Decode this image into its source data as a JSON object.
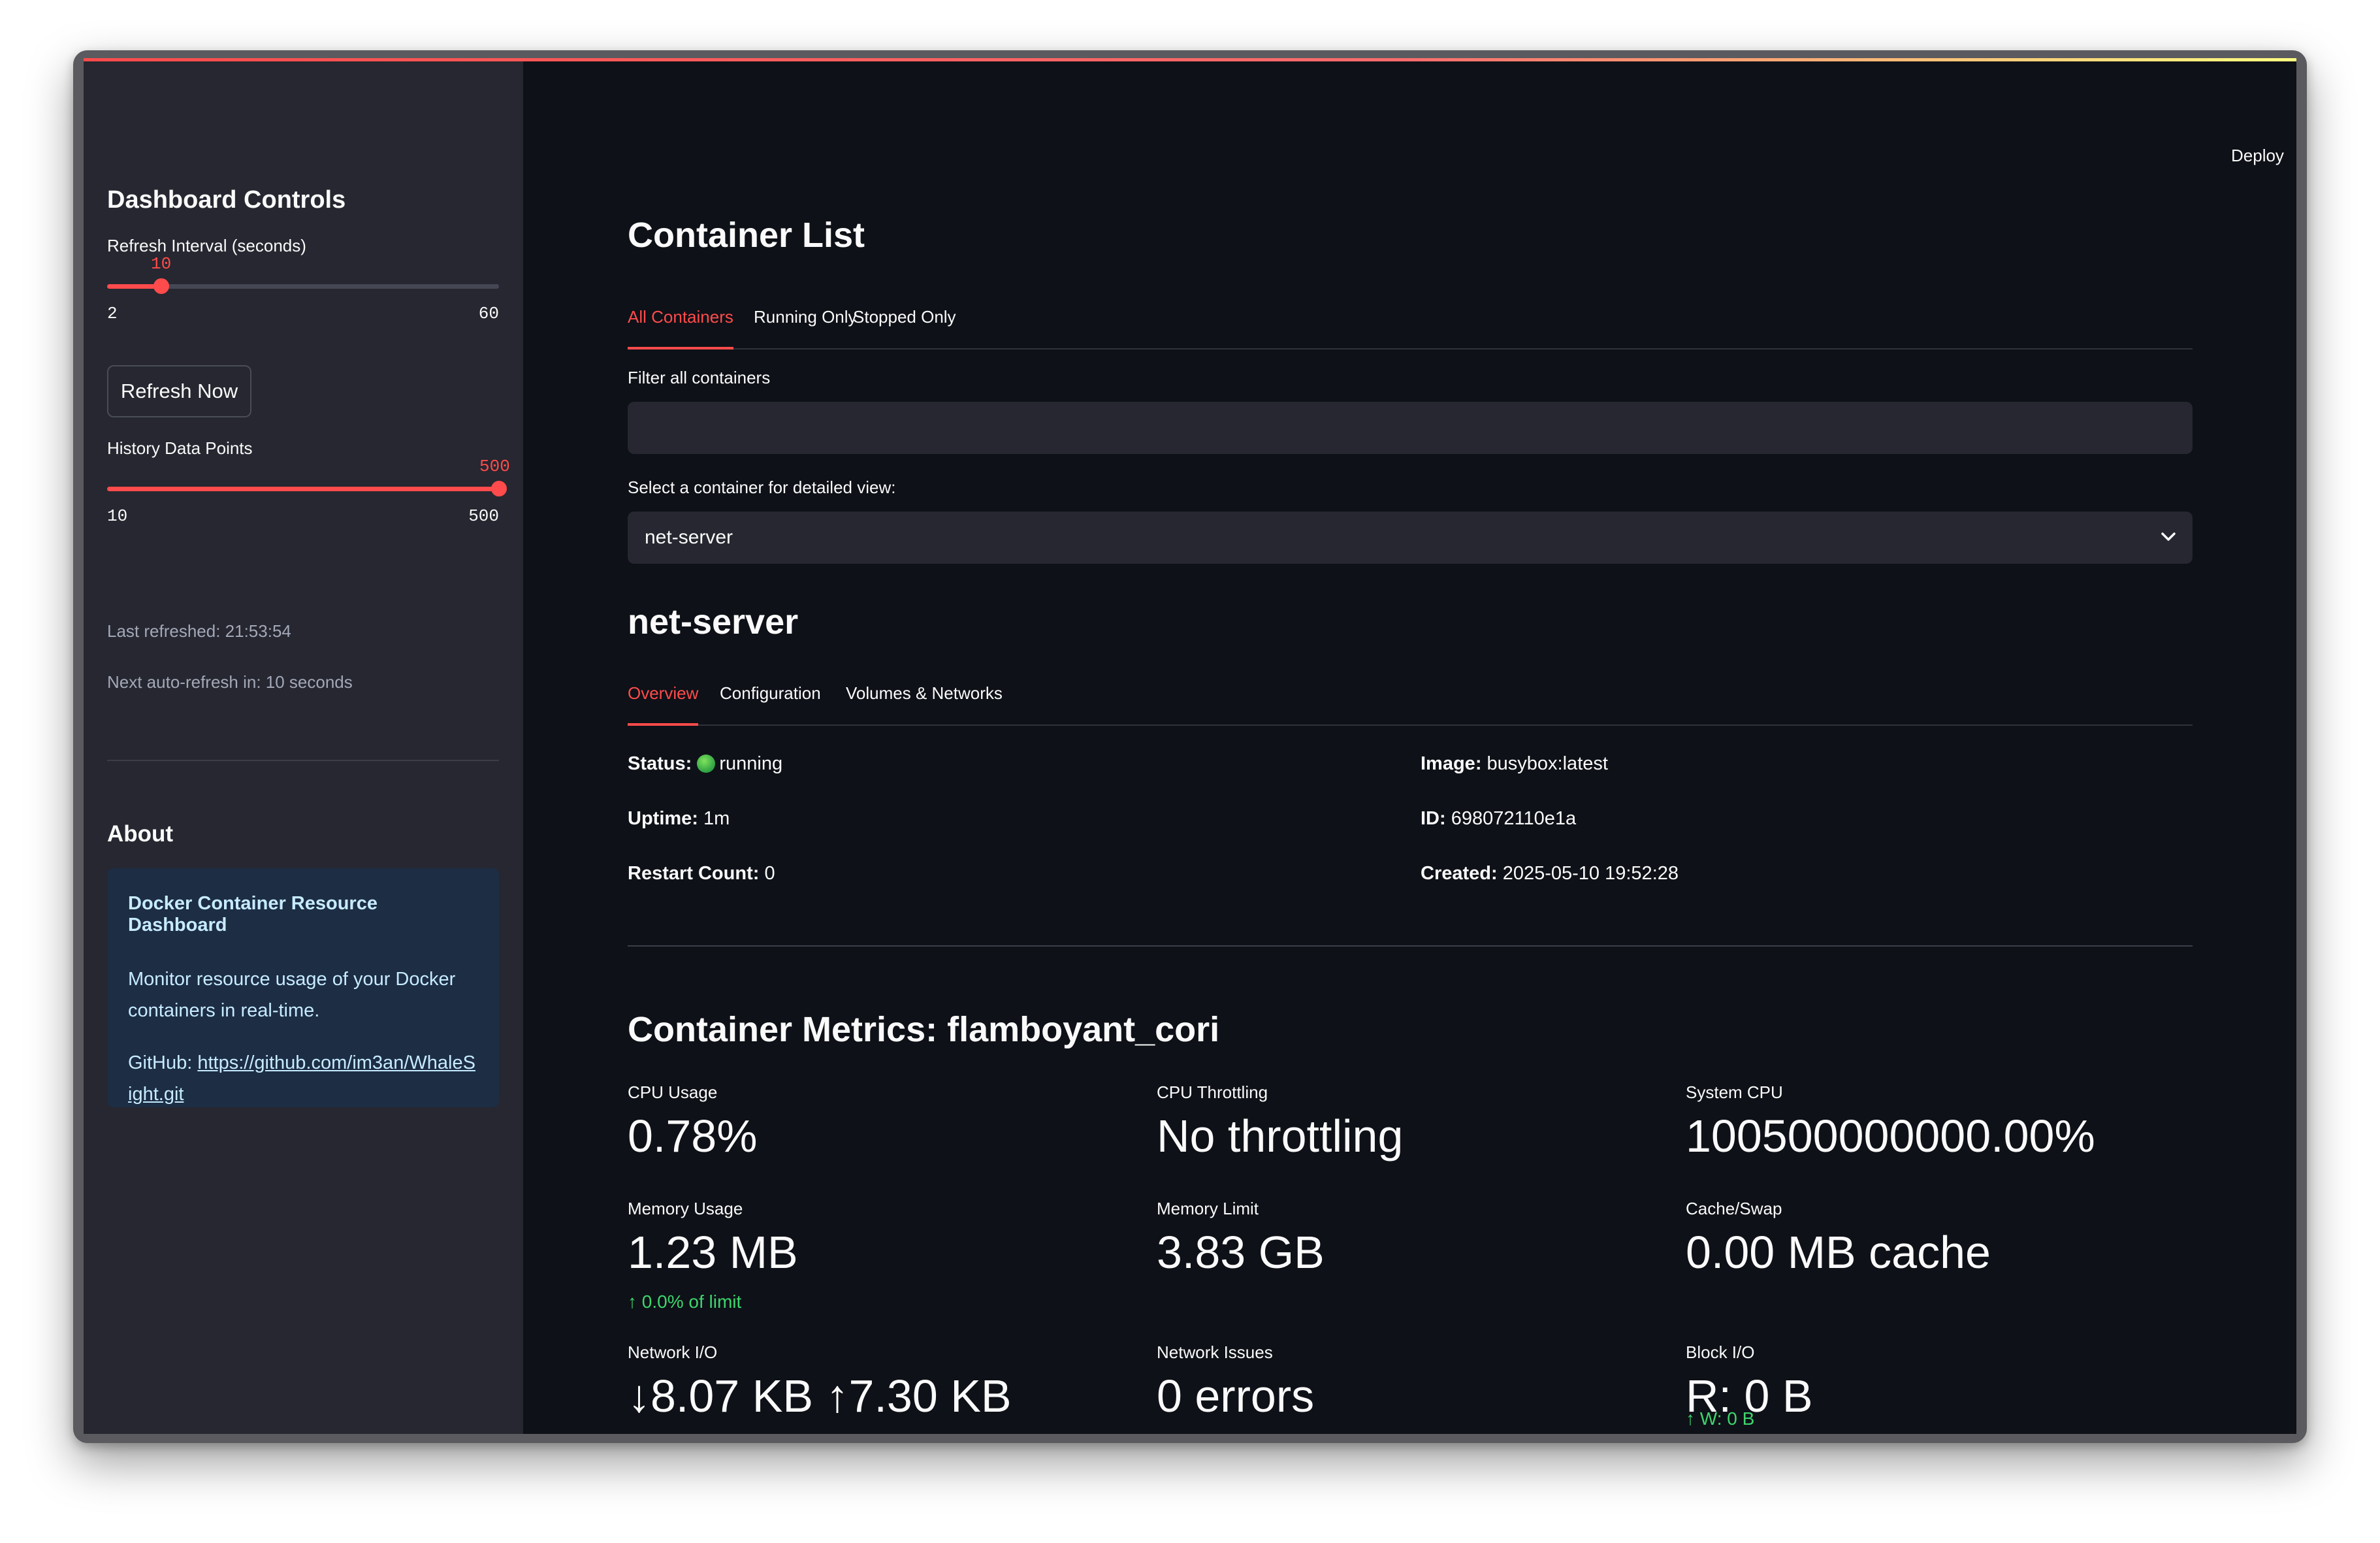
{
  "header": {
    "deploy_label": "Deploy",
    "menu_icon": "kebab-menu-icon"
  },
  "sidebar": {
    "title": "Dashboard Controls",
    "refresh_interval": {
      "label": "Refresh Interval (seconds)",
      "value": "10",
      "min": "2",
      "max": "60",
      "fraction": 0.138
    },
    "refresh_button": "Refresh Now",
    "history_points": {
      "label": "History Data Points",
      "value": "500",
      "min": "10",
      "max": "500",
      "fraction": 1.0
    },
    "last_refreshed": "Last refreshed: 21:53:54",
    "next_refresh": "Next auto-refresh in: 10 seconds",
    "about_title": "About",
    "about_box": {
      "title": "Docker Container Resource Dashboard",
      "description": "Monitor resource usage of your Docker containers in real-time.",
      "github_prefix": "GitHub: ",
      "github_link": "https://github.com/im3an/WhaleSight.git"
    }
  },
  "main": {
    "title": "Container List",
    "tabs": [
      "All Containers",
      "Running Only",
      "Stopped Only"
    ],
    "filter_label": "Filter all containers",
    "filter_value": "",
    "select_label": "Select a container for detailed view:",
    "select_value": "net-server",
    "container_name": "net-server",
    "detail_tabs": [
      "Overview",
      "Configuration",
      "Volumes & Networks"
    ],
    "overview": {
      "status_label": "Status:",
      "status_value": "running",
      "uptime_label": "Uptime:",
      "uptime_value": "1m",
      "restart_label": "Restart Count:",
      "restart_value": "0",
      "image_label": "Image:",
      "image_value": "busybox:latest",
      "id_label": "ID:",
      "id_value": "698072110e1a",
      "created_label": "Created:",
      "created_value": "2025-05-10 19:52:28"
    },
    "metrics_title": "Container Metrics: flamboyant_cori",
    "metrics": {
      "cpu_usage": {
        "label": "CPU Usage",
        "value": "0.78%"
      },
      "cpu_throttling": {
        "label": "CPU Throttling",
        "value": "No throttling"
      },
      "system_cpu": {
        "label": "System CPU",
        "value": "100500000000.00%"
      },
      "memory_usage": {
        "label": "Memory Usage",
        "value": "1.23 MB",
        "delta": "0.0% of limit"
      },
      "memory_limit": {
        "label": "Memory Limit",
        "value": "3.83 GB"
      },
      "cache_swap": {
        "label": "Cache/Swap",
        "value": "0.00 MB cache"
      },
      "network_io": {
        "label": "Network I/O",
        "value": "↓8.07 KB ↑7.30 KB"
      },
      "network_issues": {
        "label": "Network Issues",
        "value": "0 errors"
      },
      "block_io": {
        "label": "Block I/O",
        "value": "R: 0 B",
        "delta": "W: 0 B"
      }
    }
  },
  "colors": {
    "accent": "#ff4b4b",
    "positive": "#3dd56d",
    "background": "#0e1117",
    "sidebar": "#262730"
  }
}
